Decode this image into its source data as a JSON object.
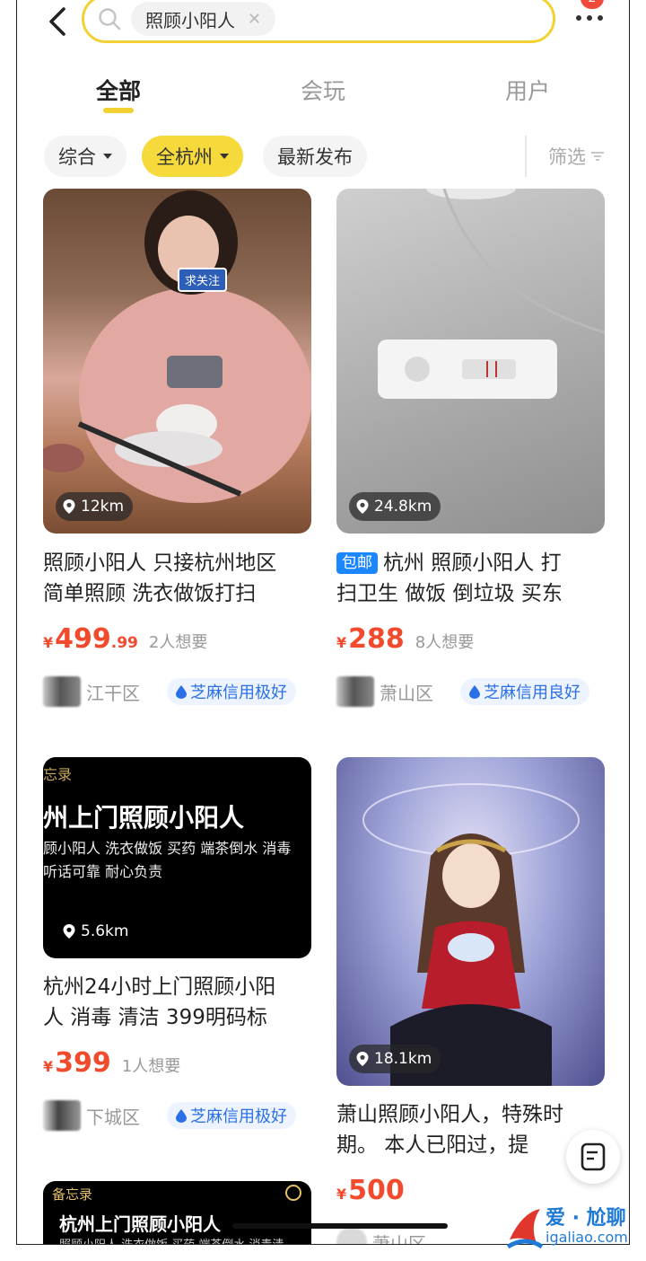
{
  "search": {
    "query": "照顾小阳人"
  },
  "notification_count": "2",
  "tabs": [
    {
      "label": "全部",
      "active": true
    },
    {
      "label": "会玩",
      "active": false
    },
    {
      "label": "用户",
      "active": false
    }
  ],
  "filters": {
    "sort": "综合",
    "city": "全杭州",
    "latest": "最新发布",
    "screen": "筛选"
  },
  "cards": [
    {
      "distance": "12km",
      "sticker": "求关注",
      "title_line1": "照顾小阳人  只接杭州地区",
      "title_line2": "简单照顾   洗衣做饭打扫",
      "price_yen": "¥",
      "price_int": "499",
      "price_dec": ".99",
      "want": "2人想要",
      "district": "江干区",
      "credit": "芝麻信用极好"
    },
    {
      "distance": "24.8km",
      "tag": "包邮",
      "title_line1": "杭州 照顾小阳人 打",
      "title_line2": "扫卫生 做饭 倒垃圾 买东",
      "price_yen": "¥",
      "price_int": "288",
      "want": "8人想要",
      "district": "萧山区",
      "credit": "芝麻信用良好"
    },
    {
      "distance": "5.6km",
      "img_text1": "忘录",
      "img_text2": "州上门照顾小阳人",
      "img_text3": "顾小阳人 洗衣做饭 买药 端茶倒水 消毒",
      "img_text4": "听话可靠 耐心负责",
      "title_line1": "杭州24小时上门照顾小阳",
      "title_line2": "人 消毒 清洁 399明码标",
      "price_yen": "¥",
      "price_int": "399",
      "want": "1人想要",
      "district": "下城区",
      "credit": "芝麻信用极好"
    },
    {
      "distance": "18.1km",
      "title_line1": "萧山照顾小阳人，特殊时",
      "title_line2": "期。 本人已阳过，提",
      "price_yen": "¥",
      "price_int": "500",
      "district": "萧山区"
    },
    {
      "img_text1": "备忘录",
      "img_text2": "杭州上门照顾小阳人",
      "img_text3": "照顾小阳人 洗衣做饭 买药 端茶倒水 消毒清"
    }
  ],
  "watermark": {
    "line1": "爱 · 尬聊",
    "line2": "igaliao.com"
  },
  "colors": {
    "accent": "#f6d93a",
    "price": "#f14a2d",
    "credit": "#2b6fe6",
    "tag": "#1a86ff"
  }
}
